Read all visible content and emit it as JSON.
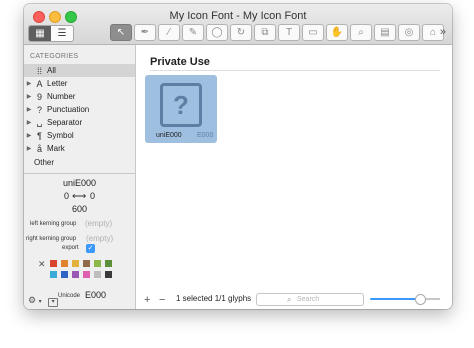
{
  "window": {
    "title": "My Icon Font - My Icon Font"
  },
  "toolbar": {
    "view_grid_icon": "grid-view-icon",
    "view_list_icon": "list-view-icon",
    "tools": [
      "pointer-icon",
      "pen-icon",
      "brush-icon",
      "pencil-icon",
      "ellipse-icon",
      "rotate-icon",
      "scale-icon",
      "text-icon",
      "speech-icon",
      "hand-icon",
      "zoom-icon",
      "ruler-icon",
      "globe-icon",
      "tag-icon"
    ],
    "overflow": "»"
  },
  "sidebar": {
    "header": "CATEGORIES",
    "items": [
      {
        "label": "All",
        "icon": "grid-dots-icon",
        "glyph": "⁞⁞",
        "selected": true
      },
      {
        "label": "Letter",
        "icon": "letter-icon",
        "glyph": "A"
      },
      {
        "label": "Number",
        "icon": "number-icon",
        "glyph": "9"
      },
      {
        "label": "Punctuation",
        "icon": "punctuation-icon",
        "glyph": "?"
      },
      {
        "label": "Separator",
        "icon": "separator-icon",
        "glyph": "␣"
      },
      {
        "label": "Symbol",
        "icon": "symbol-icon",
        "glyph": "¶"
      },
      {
        "label": "Mark",
        "icon": "mark-icon",
        "glyph": "å"
      },
      {
        "label": "Other",
        "icon": "",
        "glyph": ""
      }
    ]
  },
  "glyph_info": {
    "name": "uniE000",
    "left_sidebearing": "0",
    "right_sidebearing": "0",
    "width": "600",
    "left_kerning_label": "left kerning group",
    "right_kerning_label": "right kerning group",
    "kerning_placeholder": "(empty)",
    "export_label": "export",
    "export_checked": true,
    "colors": [
      "#d9442f",
      "#e0832c",
      "#e3b23c",
      "#8f6b4a",
      "#8cb84a",
      "#5c8f3a",
      "#3aa9d8",
      "#2f63c4",
      "#9b59b6",
      "#e060b0",
      "#bdbdbd",
      "#3a3a3a"
    ],
    "unicode_label": "Unicode",
    "unicode_value": "E000"
  },
  "main": {
    "section_title": "Private Use",
    "glyphs": [
      {
        "name": "uniE000",
        "code": "E000",
        "placeholder": "?"
      }
    ],
    "status": "1 selected 1/1 glyphs",
    "search_placeholder": "Search"
  },
  "bottom": {
    "gear": "⚙",
    "add": "+",
    "remove": "−"
  }
}
